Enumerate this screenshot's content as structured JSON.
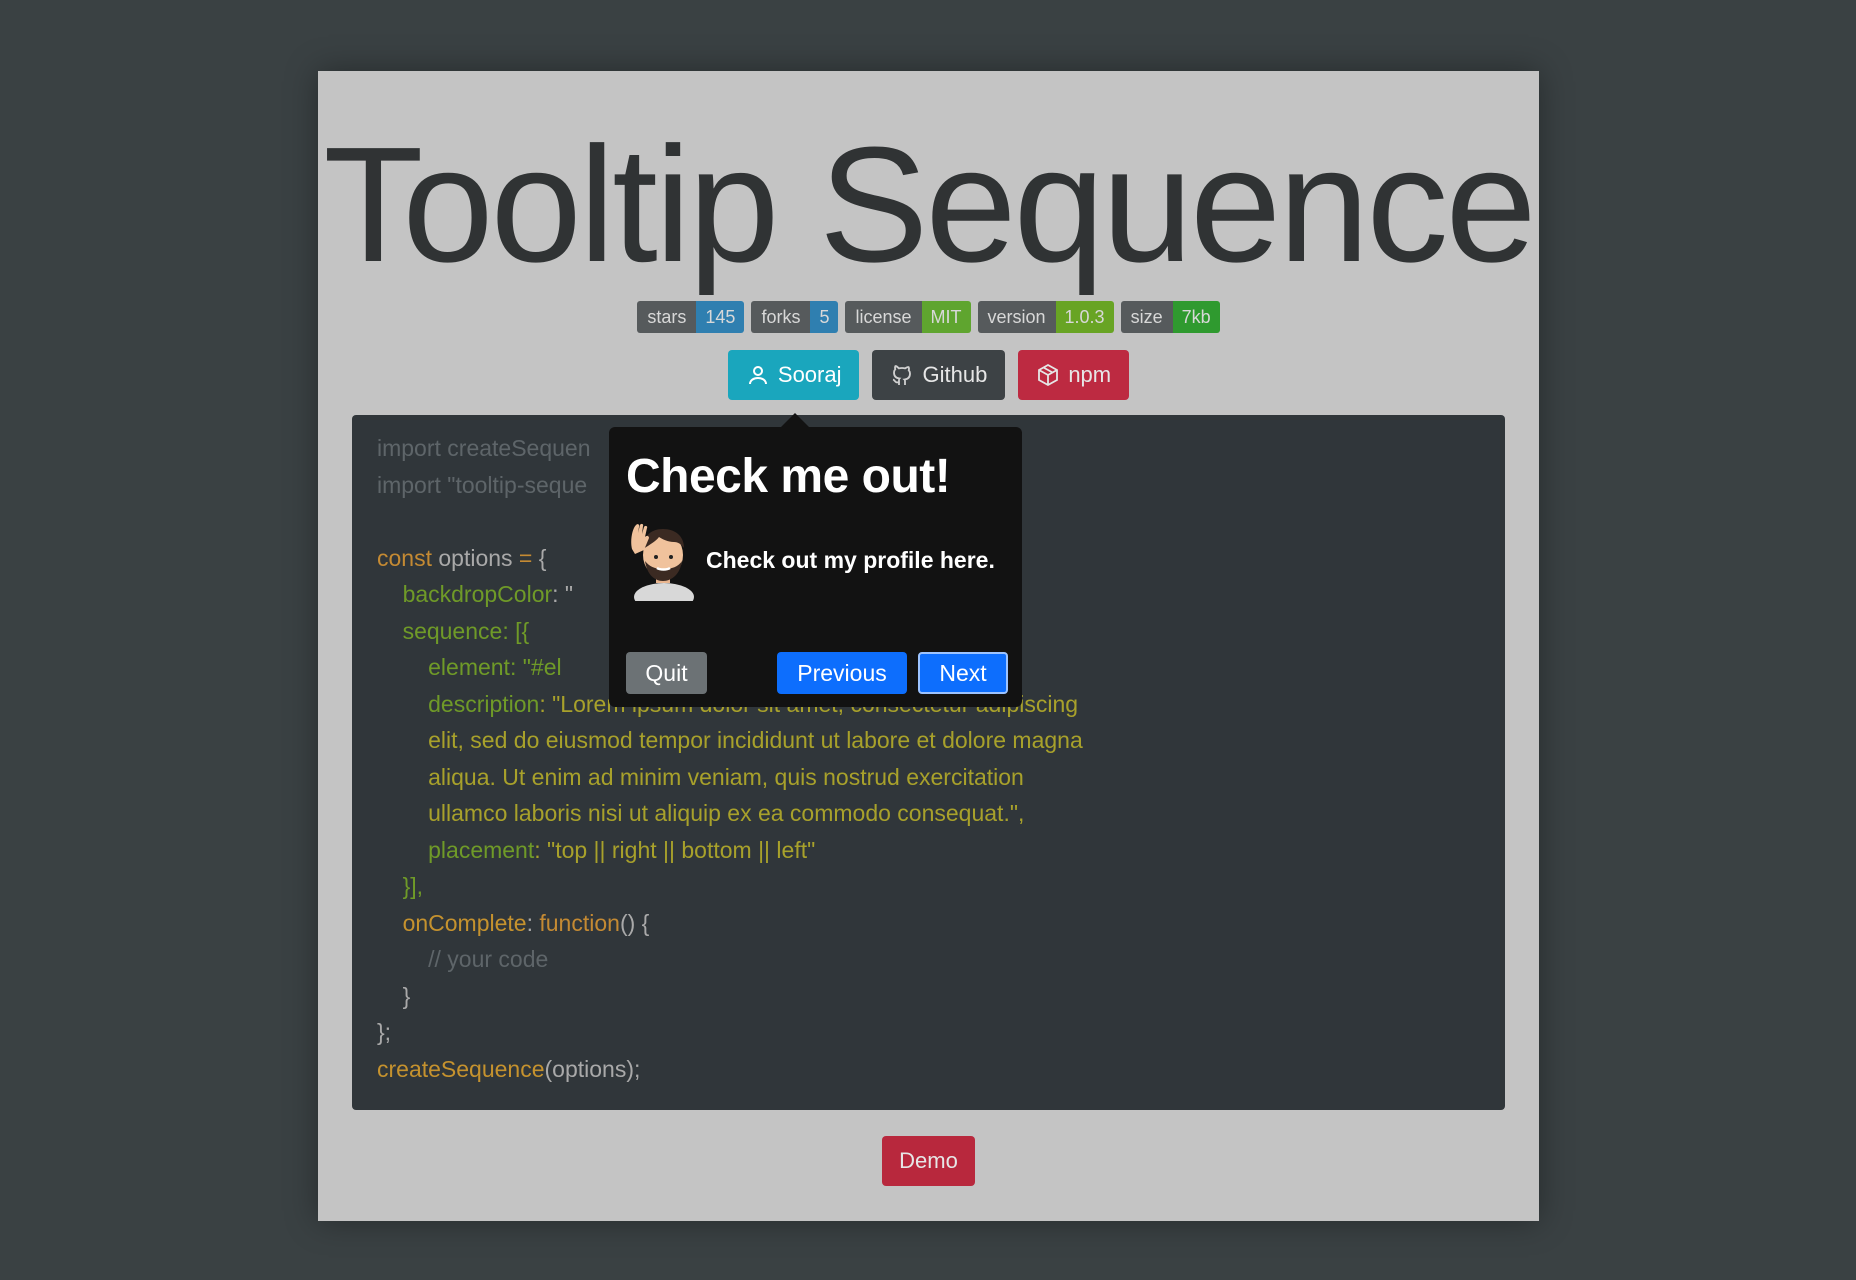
{
  "title": "Tooltip Sequence",
  "badges": [
    {
      "key": "stars",
      "value": "145",
      "color": "#2f7fb0"
    },
    {
      "key": "forks",
      "value": "5",
      "color": "#2f7fb0"
    },
    {
      "key": "license",
      "value": "MIT",
      "color": "#5fa52f"
    },
    {
      "key": "version",
      "value": "1.0.3",
      "color": "#68a424"
    },
    {
      "key": "size",
      "value": "7kb",
      "color": "#2f9a2f"
    }
  ],
  "buttons": {
    "sooraj": {
      "label": "Sooraj",
      "icon": "user-icon",
      "color": "#1aa6bd"
    },
    "github": {
      "label": "Github",
      "icon": "github-icon",
      "color": "#3d4245"
    },
    "npm": {
      "label": "npm",
      "icon": "box-icon",
      "color": "#bd2a41"
    }
  },
  "code": {
    "line1": "import createSequen",
    "line2": "import \"tooltip-seque",
    "const_kw": "const",
    "options_id": "options",
    "eq": " = ",
    "open_brace": "{",
    "backdrop_key": "backdropColor",
    "backdrop_rest": ": \"",
    "sequence_key": "sequence",
    "sequence_rest": ": [{",
    "element_key": "element",
    "element_rest": ": \"#el",
    "description_key": "description",
    "description_rest": ": \"Lorem ipsum dolor sit amet, consectetur adipiscing",
    "desc_line2": "elit, sed do eiusmod tempor incididunt ut labore et dolore magna",
    "desc_line3": "aliqua. Ut enim ad minim veniam, quis nostrud exercitation",
    "desc_line4": "ullamco laboris nisi ut aliquip ex ea commodo consequat.\",",
    "placement_key": "placement",
    "placement_rest": ": \"top || right || bottom || left\"",
    "close_seq": "}],",
    "oncomplete_key": "onComplete",
    "oncomplete_colon": ": ",
    "function_kw": "function",
    "function_rest": "() {",
    "comment": "// your code",
    "close_fn": "}",
    "close_obj": "};",
    "call_fn": "createSequence",
    "call_args": "(options);"
  },
  "demo_label": "Demo",
  "tooltip": {
    "title": "Check me out!",
    "description": "Check out my profile here.",
    "quit_label": "Quit",
    "previous_label": "Previous",
    "next_label": "Next"
  }
}
